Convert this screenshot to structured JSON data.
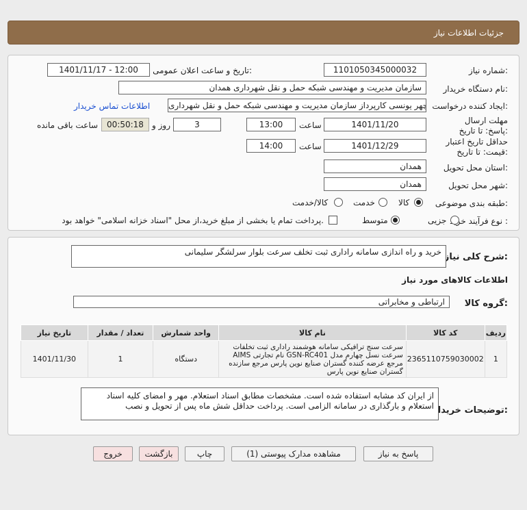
{
  "header": {
    "title": "جزئیات اطلاعات نیاز"
  },
  "info": {
    "need_number_label": "شماره نیاز:",
    "need_number": "1101050345000032",
    "announce_label": "تاریخ و ساعت اعلان عمومی:",
    "announce_value": "1401/11/17 - 12:00",
    "buyer_org_label": "نام دستگاه خریدار:",
    "buyer_org": "سازمان مدیریت و مهندسی شبکه حمل و نقل شهرداری همدان",
    "creator_label": "ایجاد کننده درخواست:",
    "creator": "منوچهر یونسی کارپرداز سازمان مدیریت و مهندسی شبکه حمل و نقل شهرداری",
    "contact_link": "اطلاعات تماس خریدار",
    "deadline_label": "مهلت ارسال پاسخ: تا تاریخ:",
    "deadline_date": "1401/11/20",
    "time_label": "ساعت",
    "deadline_time": "13:00",
    "days_value": "3",
    "days_label": "روز و",
    "remaining_time": "00:50:18",
    "remaining_label": "ساعت باقی مانده",
    "validity_label": "حداقل تاریخ اعتبار قیمت: تا تاریخ:",
    "validity_date": "1401/12/29",
    "validity_time": "14:00",
    "province_label": "استان محل تحویل:",
    "province": "همدان",
    "city_label": "شهر محل تحویل:",
    "city": "همدان",
    "category_label": "طبقه بندی موضوعی:",
    "category_options": [
      "کالا",
      "خدمت",
      "کالا/خدمت"
    ],
    "process_label": "نوع فرآیند خرید :",
    "process_options": [
      "جزیی",
      "متوسط"
    ],
    "treasury_note": "پرداخت تمام یا بخشی از مبلغ خرید،از محل \"اسناد خزانه اسلامی\" خواهد بود."
  },
  "description": {
    "label": "شرح کلی نیاز:",
    "value": "خرید و راه اندازی سامانه راداری ثبت تخلف سرعت بلوار سرلشگر سلیمانی"
  },
  "goods": {
    "section_title": "اطلاعات کالاهای مورد نیاز",
    "group_label": "گروه کالا:",
    "group_value": "ارتباطی و مخابراتی",
    "columns": [
      "ردیف",
      "کد کالا",
      "نام کالا",
      "واحد شمارش",
      "تعداد / مقدار",
      "تاریخ نیاز"
    ],
    "rows": [
      {
        "index": "1",
        "code": "2365110759030002",
        "name": "سرعت سنج ترافیکی سامانه هوشمند راداری ثبت تخلفات سرعت نسل چهارم مدل GSN-RC401 نام تجارتی AIMS مرجع عرضه کننده گستران صنایع نوین پارس مرجع سازنده گستران صنایع نوین پارس",
        "unit": "دستگاه",
        "qty": "1",
        "date": "1401/11/30"
      }
    ]
  },
  "buyer_notes": {
    "label": "توضیحات خریدار:",
    "value": "از ایران کد مشابه استفاده شده است. مشخصات مطابق اسناد استعلام. مهر و امضای کلیه اسناد استعلام و بارگذاری در سامانه الزامی است. پرداخت حداقل شش ماه پس از تحویل و نصب"
  },
  "buttons": {
    "reply": "پاسخ به نیاز",
    "attachments": "مشاهده مدارک پیوستی (1)",
    "print": "چاپ",
    "back": "بازگشت",
    "exit": "خروج"
  }
}
